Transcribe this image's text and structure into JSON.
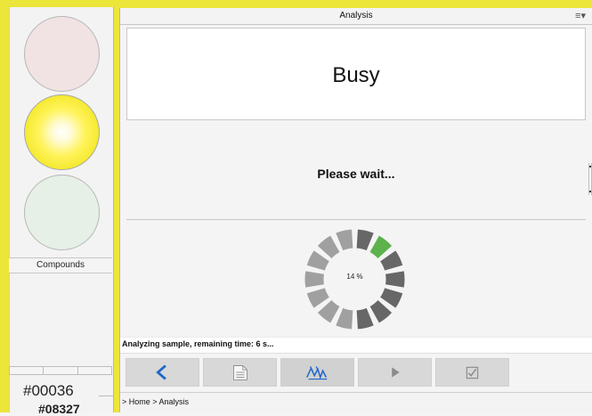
{
  "left_panel": {
    "compounds_label": "Compounds",
    "ids": [
      "#00036",
      "#08327"
    ]
  },
  "window": {
    "title": "Analysis",
    "menu_icon": "≡▾"
  },
  "status": {
    "headline": "Busy",
    "subtext": "Please wait...",
    "progress_percent": 14,
    "progress_label": "14 %",
    "message": "Analyzing sample, remaining time: 6 s..."
  },
  "toolbar": {
    "buttons": [
      {
        "icon": "back-arrow-icon"
      },
      {
        "icon": "document-icon"
      },
      {
        "icon": "waveform-icon"
      },
      {
        "icon": "play-icon"
      },
      {
        "icon": "checkmark-icon"
      }
    ]
  },
  "breadcrumb": "> Home > Analysis",
  "colors": {
    "frame": "#ece53a",
    "progress_active": "#5db24c",
    "progress_dark": "#676767",
    "progress_light": "#a0a0a0"
  }
}
